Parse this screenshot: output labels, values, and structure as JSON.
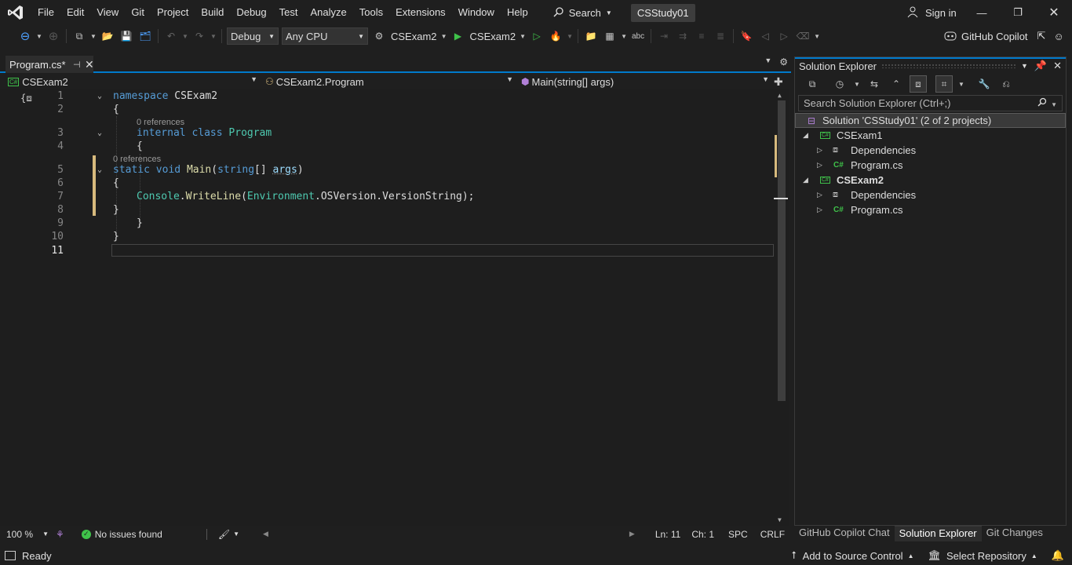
{
  "menu": {
    "items": [
      "File",
      "Edit",
      "View",
      "Git",
      "Project",
      "Build",
      "Debug",
      "Test",
      "Analyze",
      "Tools",
      "Extensions",
      "Window",
      "Help"
    ],
    "search_label": "Search",
    "solution_name": "CSStudy01",
    "sign_in": "Sign in"
  },
  "toolbar": {
    "configuration": "Debug",
    "platform": "Any CPU",
    "startup_project": "CSExam2",
    "run_target": "CSExam2",
    "copilot_label": "GitHub Copilot"
  },
  "editor": {
    "tab_label": "Program.cs*",
    "nav": {
      "project": "CSExam2",
      "type": "CSExam2.Program",
      "member": "Main(string[] args)"
    },
    "line_numbers": [
      "1",
      "2",
      "3",
      "4",
      "5",
      "6",
      "7",
      "8",
      "9",
      "10",
      "11"
    ],
    "codelens": [
      "0 references",
      "0 references"
    ],
    "zoom": "100 %",
    "issues": "No issues found",
    "position": {
      "line": "Ln: 11",
      "col": "Ch: 1",
      "spacing": "SPC",
      "eol": "CRLF"
    }
  },
  "code": {
    "l1_kw": "namespace",
    "l1_name": "CSExam2",
    "brace_open": "{",
    "brace_close": "}",
    "l3_kw1": "internal",
    "l3_kw2": "class",
    "l3_type": "Program",
    "l5_kw1": "static",
    "l5_kw2": "void",
    "l5_method": "Main",
    "l5_paren": "(",
    "l5_ptype": "string",
    "l5_brackets": "[] ",
    "l5_param": "args",
    "l5_close": ")",
    "l7_cls": "Console",
    "l7_dot1": ".",
    "l7_meth": "WriteLine",
    "l7_paren": "(",
    "l7_env": "Environment",
    "l7_dot2": ".",
    "l7_os": "OSVersion",
    "l7_dot3": ".",
    "l7_vs": "VersionString",
    "l7_end": ");"
  },
  "solution_explorer": {
    "title": "Solution Explorer",
    "search_placeholder": "Search Solution Explorer (Ctrl+;)",
    "solution": "Solution 'CSStudy01' (2 of 2 projects)",
    "projects": [
      {
        "name": "CSExam1",
        "children": [
          "Dependencies",
          "Program.cs"
        ]
      },
      {
        "name": "CSExam2",
        "children": [
          "Dependencies",
          "Program.cs"
        ]
      }
    ],
    "tabs": [
      "GitHub Copilot Chat",
      "Solution Explorer",
      "Git Changes"
    ]
  },
  "statusbar": {
    "ready": "Ready",
    "source_control": "Add to Source Control",
    "repository": "Select Repository"
  },
  "colors": {
    "accent": "#007acc",
    "keyword": "#569cd6",
    "type": "#4ec9b0",
    "method": "#dcdcaa",
    "run_green": "#3fc24a",
    "vs_purple": "#b180d7"
  }
}
